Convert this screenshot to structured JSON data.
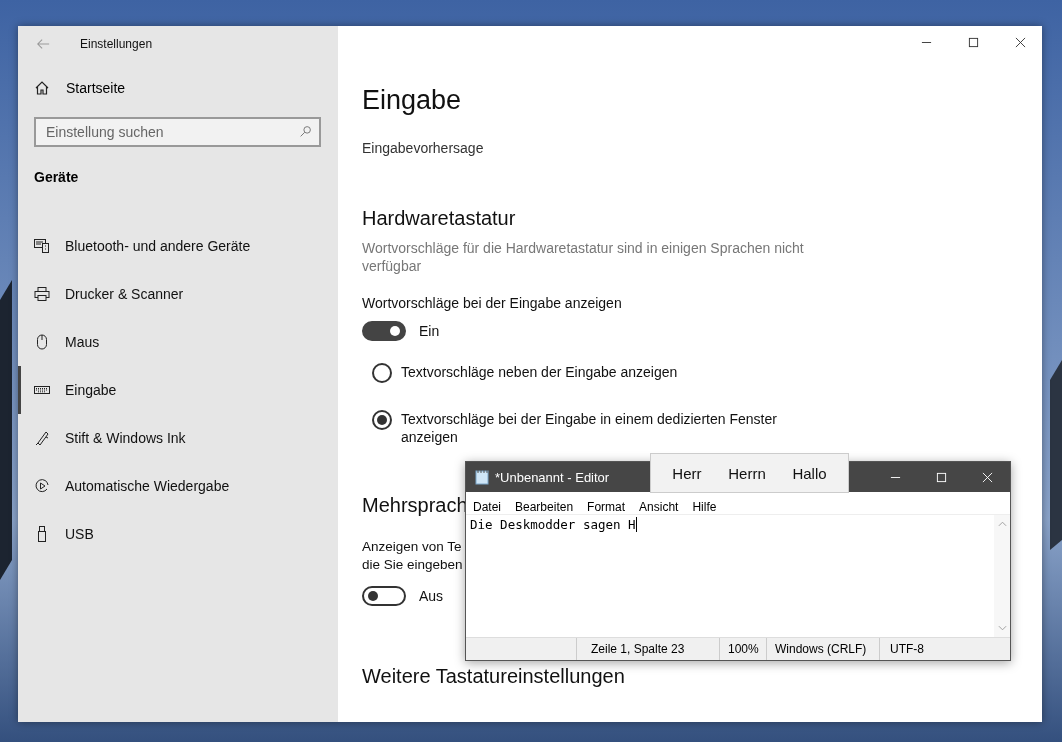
{
  "settings_window": {
    "title": "Einstellungen",
    "home": "Startseite",
    "search": {
      "placeholder": "Einstellung suchen"
    },
    "category": "Geräte",
    "nav": [
      {
        "label": "Bluetooth- und andere Geräte",
        "kind": "devices",
        "selected": false
      },
      {
        "label": "Drucker & Scanner",
        "kind": "printer",
        "selected": false
      },
      {
        "label": "Maus",
        "kind": "mouse",
        "selected": false
      },
      {
        "label": "Eingabe",
        "kind": "keyboard",
        "selected": true
      },
      {
        "label": "Stift & Windows Ink",
        "kind": "pen",
        "selected": false
      },
      {
        "label": "Automatische Wiedergabe",
        "kind": "autoplay",
        "selected": false
      },
      {
        "label": "USB",
        "kind": "usb",
        "selected": false
      }
    ]
  },
  "page": {
    "title": "Eingabe",
    "link": "Eingabevorhersage",
    "hardware": {
      "heading": "Hardwaretastatur",
      "note": "Wortvorschläge für die Hardwaretastatur sind in einigen Sprachen nicht verfügbar",
      "setting_label": "Wortvorschläge bei der Eingabe anzeigen",
      "toggle": {
        "on": true,
        "label": "Ein"
      },
      "options": [
        {
          "label": "Textvorschläge neben der Eingabe anzeigen",
          "selected": false
        },
        {
          "label": "Textvorschläge bei der Eingabe in einem dedizierten Fenster anzeigen",
          "selected": true
        }
      ]
    },
    "multilingual": {
      "heading": "Mehrsprach",
      "description_lines": [
        "Anzeigen von Te",
        "die Sie eingeben"
      ],
      "toggle": {
        "on": false,
        "label": "Aus"
      }
    },
    "more": {
      "heading": "Weitere Tastatureinstellungen"
    }
  },
  "editor": {
    "title": "*Unbenannt - Editor",
    "menu": [
      "Datei",
      "Bearbeiten",
      "Format",
      "Ansicht",
      "Hilfe"
    ],
    "text": "Die Deskmodder sagen H",
    "status": [
      "Zeile 1, Spalte 23",
      "100%",
      "Windows (CRLF)",
      "UTF-8"
    ]
  },
  "suggestions": [
    "Herr",
    "Herrn",
    "Hallo"
  ]
}
